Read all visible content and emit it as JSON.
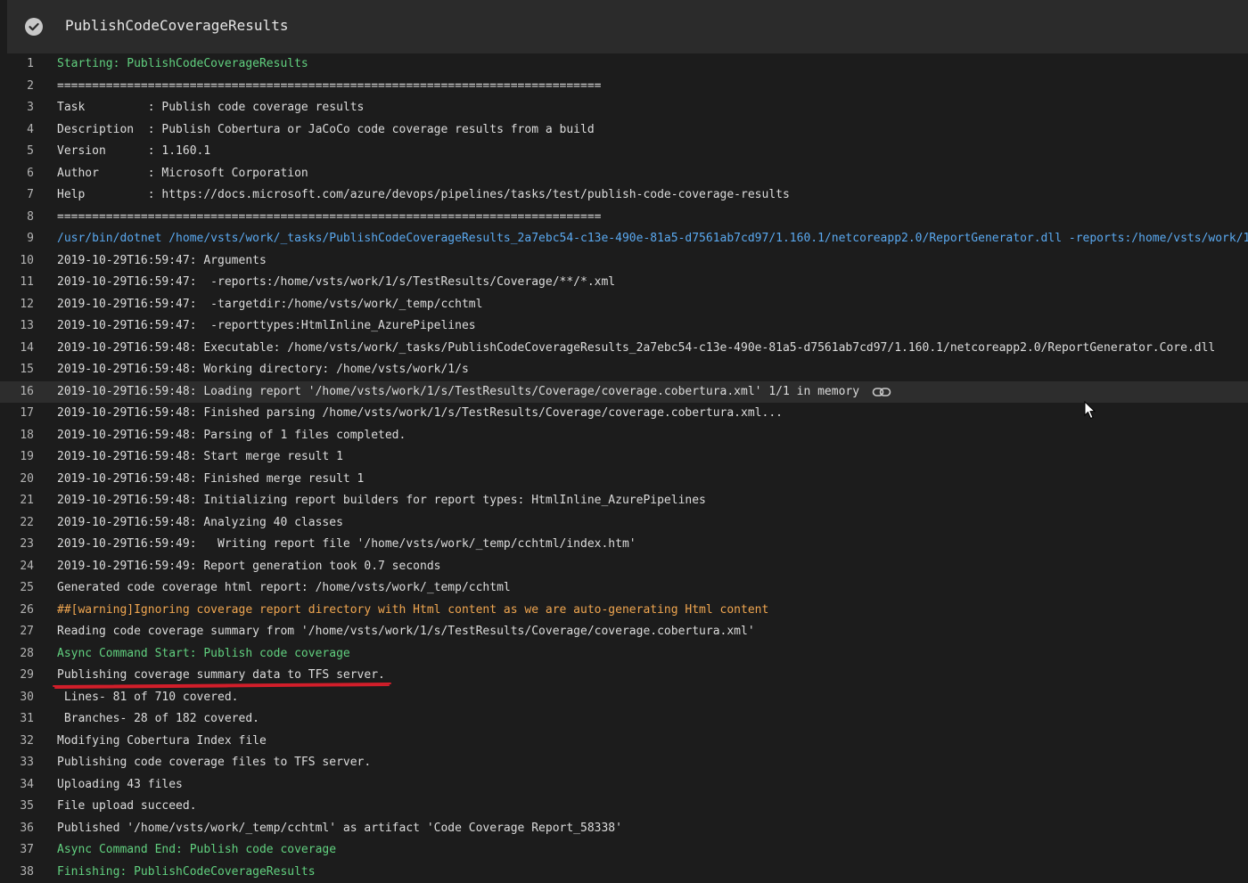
{
  "header": {
    "title": "PublishCodeCoverageResults",
    "status_icon": "check-circle-icon"
  },
  "colors": {
    "section": "#61d07f",
    "command": "#5aa9f0",
    "warning": "#f0a650",
    "normal": "#dcdcdc",
    "annotation": "#d21e2a"
  },
  "lines": [
    {
      "num": "1",
      "text": "Starting: PublishCodeCoverageResults",
      "kind": "section"
    },
    {
      "num": "2",
      "text": "==============================================================================",
      "kind": "normal"
    },
    {
      "num": "3",
      "text": "Task         : Publish code coverage results",
      "kind": "normal"
    },
    {
      "num": "4",
      "text": "Description  : Publish Cobertura or JaCoCo code coverage results from a build",
      "kind": "normal"
    },
    {
      "num": "5",
      "text": "Version      : 1.160.1",
      "kind": "normal"
    },
    {
      "num": "6",
      "text": "Author       : Microsoft Corporation",
      "kind": "normal"
    },
    {
      "num": "7",
      "text": "Help         : https://docs.microsoft.com/azure/devops/pipelines/tasks/test/publish-code-coverage-results",
      "kind": "normal"
    },
    {
      "num": "8",
      "text": "==============================================================================",
      "kind": "normal"
    },
    {
      "num": "9",
      "text": "/usr/bin/dotnet /home/vsts/work/_tasks/PublishCodeCoverageResults_2a7ebc54-c13e-490e-81a5-d7561ab7cd97/1.160.1/netcoreapp2.0/ReportGenerator.dll -reports:/home/vsts/work/1",
      "kind": "command"
    },
    {
      "num": "10",
      "text": "2019-10-29T16:59:47: Arguments",
      "kind": "normal"
    },
    {
      "num": "11",
      "text": "2019-10-29T16:59:47:  -reports:/home/vsts/work/1/s/TestResults/Coverage/**/*.xml",
      "kind": "normal"
    },
    {
      "num": "12",
      "text": "2019-10-29T16:59:47:  -targetdir:/home/vsts/work/_temp/cchtml",
      "kind": "normal"
    },
    {
      "num": "13",
      "text": "2019-10-29T16:59:47:  -reporttypes:HtmlInline_AzurePipelines",
      "kind": "normal"
    },
    {
      "num": "14",
      "text": "2019-10-29T16:59:48: Executable: /home/vsts/work/_tasks/PublishCodeCoverageResults_2a7ebc54-c13e-490e-81a5-d7561ab7cd97/1.160.1/netcoreapp2.0/ReportGenerator.Core.dll",
      "kind": "normal"
    },
    {
      "num": "15",
      "text": "2019-10-29T16:59:48: Working directory: /home/vsts/work/1/s",
      "kind": "normal"
    },
    {
      "num": "16",
      "text": "2019-10-29T16:59:48: Loading report '/home/vsts/work/1/s/TestResults/Coverage/coverage.cobertura.xml' 1/1 in memory",
      "kind": "normal",
      "highlight": true
    },
    {
      "num": "17",
      "text": "2019-10-29T16:59:48: Finished parsing /home/vsts/work/1/s/TestResults/Coverage/coverage.cobertura.xml...",
      "kind": "normal"
    },
    {
      "num": "18",
      "text": "2019-10-29T16:59:48: Parsing of 1 files completed.",
      "kind": "normal"
    },
    {
      "num": "19",
      "text": "2019-10-29T16:59:48: Start merge result 1",
      "kind": "normal"
    },
    {
      "num": "20",
      "text": "2019-10-29T16:59:48: Finished merge result 1",
      "kind": "normal"
    },
    {
      "num": "21",
      "text": "2019-10-29T16:59:48: Initializing report builders for report types: HtmlInline_AzurePipelines",
      "kind": "normal"
    },
    {
      "num": "22",
      "text": "2019-10-29T16:59:48: Analyzing 40 classes",
      "kind": "normal"
    },
    {
      "num": "23",
      "text": "2019-10-29T16:59:49:   Writing report file '/home/vsts/work/_temp/cchtml/index.htm'",
      "kind": "normal"
    },
    {
      "num": "24",
      "text": "2019-10-29T16:59:49: Report generation took 0.7 seconds",
      "kind": "normal"
    },
    {
      "num": "25",
      "text": "Generated code coverage html report: /home/vsts/work/_temp/cchtml",
      "kind": "normal"
    },
    {
      "num": "26",
      "text": "##[warning]Ignoring coverage report directory with Html content as we are auto-generating Html content",
      "kind": "warning"
    },
    {
      "num": "27",
      "text": "Reading code coverage summary from '/home/vsts/work/1/s/TestResults/Coverage/coverage.cobertura.xml'",
      "kind": "normal"
    },
    {
      "num": "28",
      "text": "Async Command Start: Publish code coverage",
      "kind": "section"
    },
    {
      "num": "29",
      "text": "Publishing coverage summary data to TFS server.",
      "kind": "normal"
    },
    {
      "num": "30",
      "text": " Lines- 81 of 710 covered.",
      "kind": "normal"
    },
    {
      "num": "31",
      "text": " Branches- 28 of 182 covered.",
      "kind": "normal"
    },
    {
      "num": "32",
      "text": "Modifying Cobertura Index file",
      "kind": "normal"
    },
    {
      "num": "33",
      "text": "Publishing code coverage files to TFS server.",
      "kind": "normal"
    },
    {
      "num": "34",
      "text": "Uploading 43 files",
      "kind": "normal"
    },
    {
      "num": "35",
      "text": "File upload succeed.",
      "kind": "normal"
    },
    {
      "num": "36",
      "text": "Published '/home/vsts/work/_temp/cchtml' as artifact 'Code Coverage Report_58338'",
      "kind": "normal"
    },
    {
      "num": "37",
      "text": "Async Command End: Publish code coverage",
      "kind": "section"
    },
    {
      "num": "38",
      "text": "Finishing: PublishCodeCoverageResults",
      "kind": "section"
    }
  ],
  "row_actions": {
    "link_icon": "link-icon"
  },
  "annotation": {
    "underline_icon": "red-underline-mark"
  },
  "pointer": {
    "icon": "mouse-cursor-icon"
  }
}
